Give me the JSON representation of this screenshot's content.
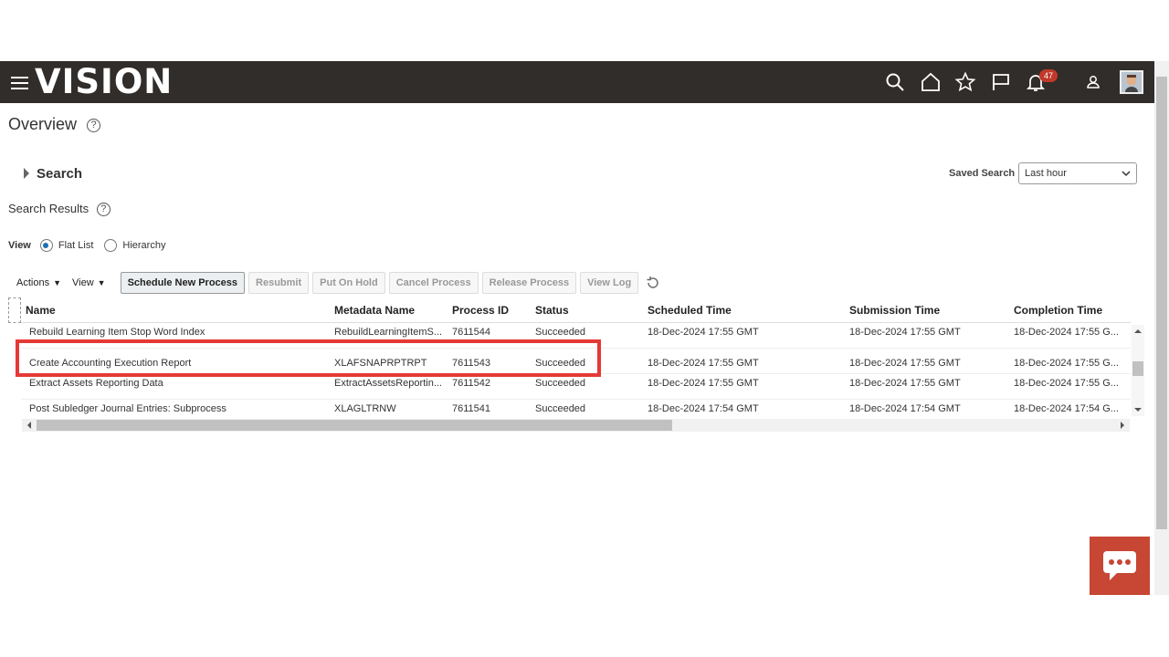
{
  "app": {
    "logo": "VISION",
    "notification_count": "47"
  },
  "page": {
    "title": "Overview",
    "help_glyph": "?"
  },
  "search": {
    "label": "Search",
    "saved_search_label": "Saved Search",
    "saved_search_value": "Last hour"
  },
  "results": {
    "title": "Search Results",
    "view_label": "View",
    "view_options": [
      {
        "label": "Flat List",
        "selected": true
      },
      {
        "label": "Hierarchy",
        "selected": false
      }
    ]
  },
  "toolbar": {
    "actions_label": "Actions",
    "view_label": "View",
    "buttons": [
      "Schedule New Process",
      "Resubmit",
      "Put On Hold",
      "Cancel Process",
      "Release Process",
      "View Log"
    ]
  },
  "table": {
    "columns": [
      "Name",
      "Metadata Name",
      "Process ID",
      "Status",
      "Scheduled Time",
      "Submission Time",
      "Completion Time"
    ],
    "rows": [
      [
        "Rebuild Learning Item Stop Word Index",
        "RebuildLearningItemS...",
        "7611544",
        "Succeeded",
        "18-Dec-2024 17:55 GMT",
        "18-Dec-2024 17:55 GMT",
        "18-Dec-2024 17:55 G..."
      ],
      [
        "Create Accounting Execution Report",
        "XLAFSNAPRPTRPT",
        "7611543",
        "Succeeded",
        "18-Dec-2024 17:55 GMT",
        "18-Dec-2024 17:55 GMT",
        "18-Dec-2024 17:55 G..."
      ],
      [
        "Extract Assets Reporting Data",
        "ExtractAssetsReportin...",
        "7611542",
        "Succeeded",
        "18-Dec-2024 17:55 GMT",
        "18-Dec-2024 17:55 GMT",
        "18-Dec-2024 17:55 G..."
      ],
      [
        "Post Subledger Journal Entries: Subprocess",
        "XLAGLTRNW",
        "7611541",
        "Succeeded",
        "18-Dec-2024 17:54 GMT",
        "18-Dec-2024 17:54 GMT",
        "18-Dec-2024 17:54 G..."
      ]
    ]
  },
  "colors": {
    "topbar": "#312d2a",
    "highlight": "#e53935",
    "chat": "#c74634",
    "badge": "#c0392b"
  }
}
